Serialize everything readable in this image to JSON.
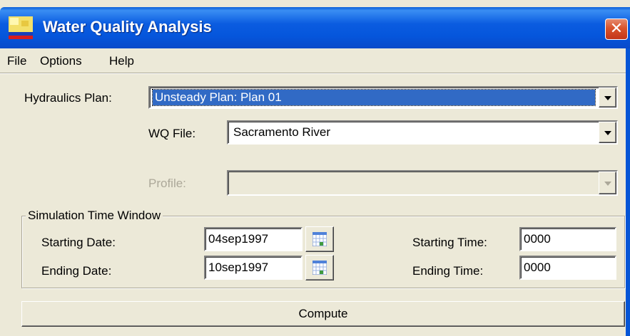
{
  "window": {
    "title": "Water Quality Analysis",
    "close_glyph": "✕"
  },
  "menu": [
    {
      "label": "File"
    },
    {
      "label": "Options"
    },
    {
      "label": "Help"
    }
  ],
  "form": {
    "hydraulics_plan": {
      "label": "Hydraulics Plan:",
      "value": "Unsteady Plan: Plan 01"
    },
    "wq_file": {
      "label": "WQ File:",
      "value": "Sacramento River"
    },
    "profile": {
      "label": "Profile:",
      "value": ""
    }
  },
  "simulation": {
    "title": "Simulation Time Window",
    "starting_date": {
      "label": "Starting Date:",
      "value": "04sep1997"
    },
    "ending_date": {
      "label": "Ending Date:",
      "value": "10sep1997"
    },
    "starting_time": {
      "label": "Starting Time:",
      "value": "0000"
    },
    "ending_time": {
      "label": "Ending Time:",
      "value": "0000"
    }
  },
  "compute_button": {
    "label": "Compute"
  },
  "colors": {
    "titlebar": "#0556dc",
    "window_bg": "#ece9d8",
    "selection": "#316ac5",
    "close_button": "#d9532b"
  },
  "icons": {
    "app": "app-icon",
    "calendar": "calendar-icon",
    "dropdown": "chevron-down-icon"
  }
}
